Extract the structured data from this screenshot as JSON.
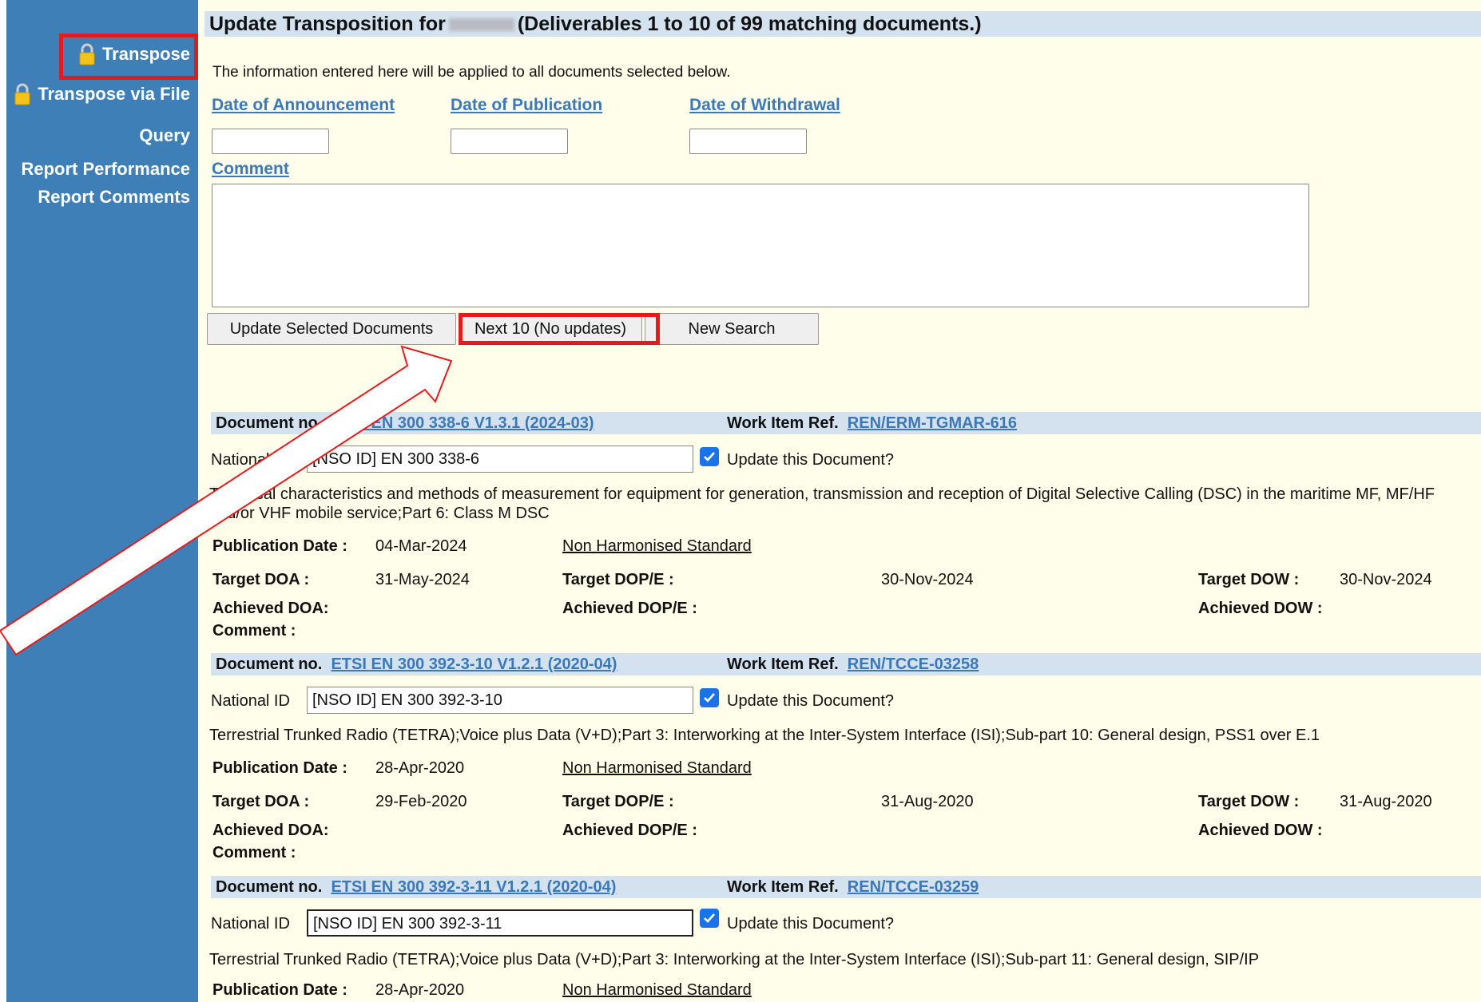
{
  "sidebar": {
    "items": [
      {
        "label": "Transpose",
        "locked": true
      },
      {
        "label": "Transpose via File",
        "locked": true
      },
      {
        "label": "Query",
        "locked": false
      },
      {
        "label": "Report Performance",
        "locked": false
      },
      {
        "label": "Report Comments",
        "locked": false
      }
    ]
  },
  "header": {
    "title_prefix": "Update Transposition for",
    "title_suffix": "(Deliverables 1 to 10 of 99 matching documents.)"
  },
  "form": {
    "info": "The information entered here will be applied to all documents selected below.",
    "date_announcement_label": "Date of Announcement",
    "date_publication_label": "Date of Publication",
    "date_withdrawal_label": "Date of Withdrawal",
    "date_announcement_value": "",
    "date_publication_value": "",
    "date_withdrawal_value": "",
    "comment_label": "Comment",
    "comment_value": ""
  },
  "buttons": {
    "update": "Update Selected Documents",
    "next": "Next 10 (No updates)",
    "new_search": "New Search"
  },
  "labels": {
    "document_no": "Document no.",
    "work_item_ref": "Work Item Ref.",
    "national_id": "National ID",
    "update_doc": "Update this Document?",
    "publication_date": "Publication Date :",
    "target_doa": "Target DOA :",
    "target_dope": "Target DOP/E :",
    "target_dow": "Target DOW :",
    "achieved_doa": "Achieved DOA:",
    "achieved_dope": "Achieved DOP/E :",
    "achieved_dow": "Achieved DOW :",
    "comment": "Comment :"
  },
  "documents": [
    {
      "doc_no": "ETSI EN 300 338-6 V1.3.1 (2024-03)",
      "work_item": "REN/ERM-TGMAR-616",
      "national_id": "[NSO ID] EN 300 338-6",
      "update_checked": true,
      "description": "Technical characteristics and methods of measurement for equipment for generation, transmission and reception of Digital Selective Calling (DSC) in the maritime MF, MF/HF and/or VHF mobile service;Part 6: Class M DSC",
      "publication_date": "04-Mar-2024",
      "standard_type": "Non Harmonised Standard",
      "target_doa": "31-May-2024",
      "target_dope": "30-Nov-2024",
      "target_dow": "30-Nov-2024"
    },
    {
      "doc_no": "ETSI EN 300 392-3-10 V1.2.1 (2020-04)",
      "work_item": "REN/TCCE-03258",
      "national_id": "[NSO ID] EN 300 392-3-10",
      "update_checked": true,
      "description": "Terrestrial Trunked Radio (TETRA);Voice plus Data (V+D);Part 3: Interworking at the Inter-System Interface (ISI);Sub-part 10: General design, PSS1 over E.1",
      "publication_date": "28-Apr-2020",
      "standard_type": "Non Harmonised Standard",
      "target_doa": "29-Feb-2020",
      "target_dope": "31-Aug-2020",
      "target_dow": "31-Aug-2020"
    },
    {
      "doc_no": "ETSI EN 300 392-3-11 V1.2.1 (2020-04)",
      "work_item": "REN/TCCE-03259",
      "national_id": "[NSO ID] EN 300 392-3-11",
      "update_checked": true,
      "description": "Terrestrial Trunked Radio (TETRA);Voice plus Data (V+D);Part 3: Interworking at the Inter-System Interface (ISI);Sub-part 11: General design, SIP/IP",
      "publication_date": "28-Apr-2020",
      "standard_type": "Non Harmonised Standard"
    }
  ],
  "colors": {
    "sidebar_bg": "#3f7fb7",
    "main_bg": "#fffeea",
    "header_band": "#d4e2ef",
    "link": "#3a78b8",
    "highlight": "#e21c1c",
    "checkbox": "#1a73e8"
  }
}
